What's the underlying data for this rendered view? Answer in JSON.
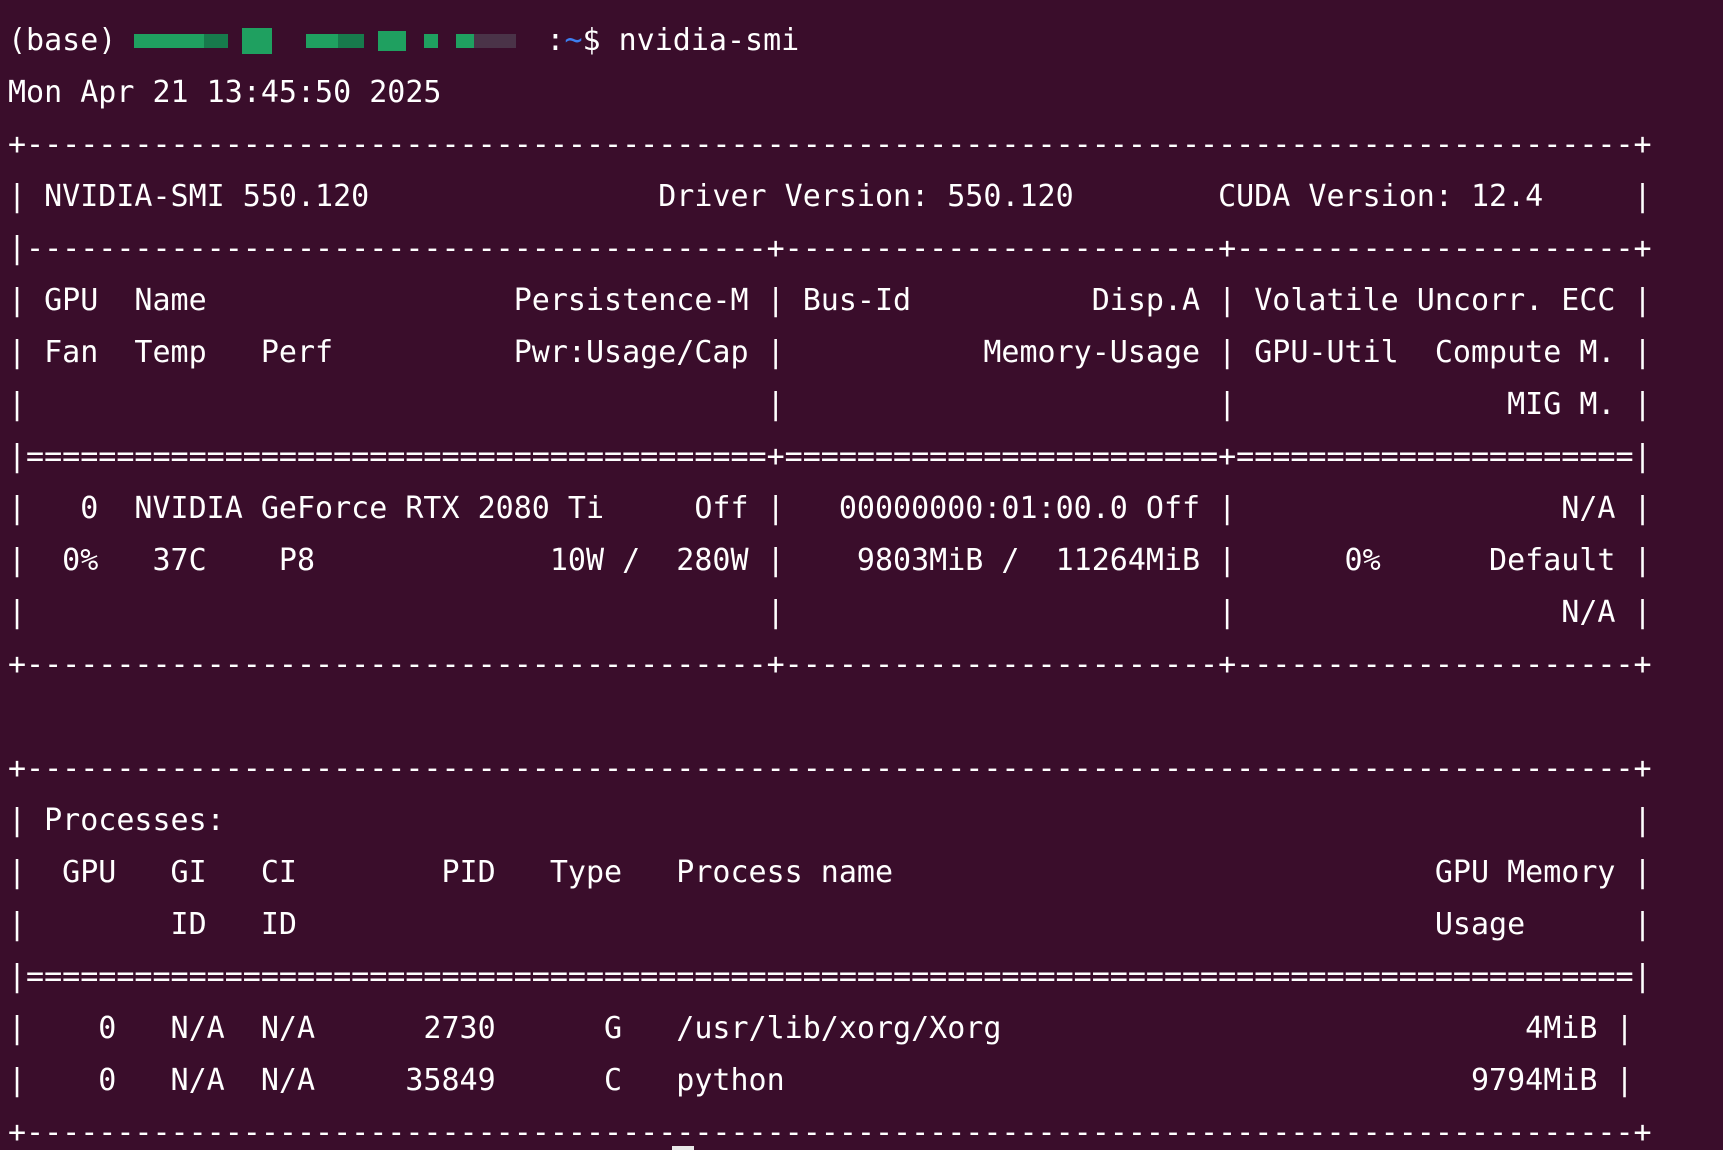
{
  "prompt": {
    "env": "(base)",
    "path": ":~$",
    "command": "nvidia-smi"
  },
  "timestamp": "Mon Apr 21 13:45:50 2025",
  "lines": [
    "+-----------------------------------------------------------------------------------------+",
    "| NVIDIA-SMI 550.120                Driver Version: 550.120        CUDA Version: 12.4     |",
    "|-----------------------------------------+------------------------+----------------------+",
    "| GPU  Name                 Persistence-M | Bus-Id          Disp.A | Volatile Uncorr. ECC |",
    "| Fan  Temp   Perf          Pwr:Usage/Cap |           Memory-Usage | GPU-Util  Compute M. |",
    "|                                         |                        |               MIG M. |",
    "|=========================================+========================+======================|",
    "|   0  NVIDIA GeForce RTX 2080 Ti     Off |   00000000:01:00.0 Off |                  N/A |",
    "|  0%   37C    P8             10W /  280W |    9803MiB /  11264MiB |      0%      Default |",
    "|                                         |                        |                  N/A |",
    "+-----------------------------------------+------------------------+----------------------+",
    "",
    "+-----------------------------------------------------------------------------------------+",
    "| Processes:                                                                              |",
    "|  GPU   GI   CI        PID   Type   Process name                              GPU Memory |",
    "|        ID   ID                                                               Usage      |",
    "|=========================================================================================|",
    "|    0   N/A  N/A      2730      G   /usr/lib/xorg/Xorg                             4MiB |",
    "|    0   N/A  N/A     35849      C   python                                      9794MiB |",
    "+-----------------------------------------------------------------------------------------+"
  ]
}
